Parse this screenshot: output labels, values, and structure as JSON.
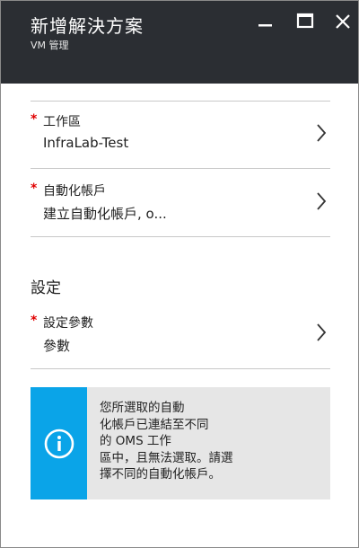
{
  "header": {
    "title": "新增解決方案",
    "subtitle": "VM 管理"
  },
  "fields": {
    "workspace": {
      "required_mark": "*",
      "label": "工作區",
      "value": "InfraLab-Test"
    },
    "automation_account": {
      "required_mark": "*",
      "label": "自動化帳戶",
      "value": "建立自動化帳戶, o..."
    },
    "settings_section_title": "設定",
    "config_params": {
      "required_mark": "*",
      "label": "設定參數",
      "value": "參數"
    }
  },
  "info_box": {
    "message": "您所選取的自動\n化帳戶已連結至不同\n的 OMS 工作\n區中，且無法選取。請選\n擇不同的自動化帳戶。",
    "icon": "info-icon",
    "accent_color": "#0aa4e8",
    "background_color": "#e6e6e6"
  },
  "colors": {
    "header_bg": "#2b2e33",
    "required": "#e00000"
  }
}
